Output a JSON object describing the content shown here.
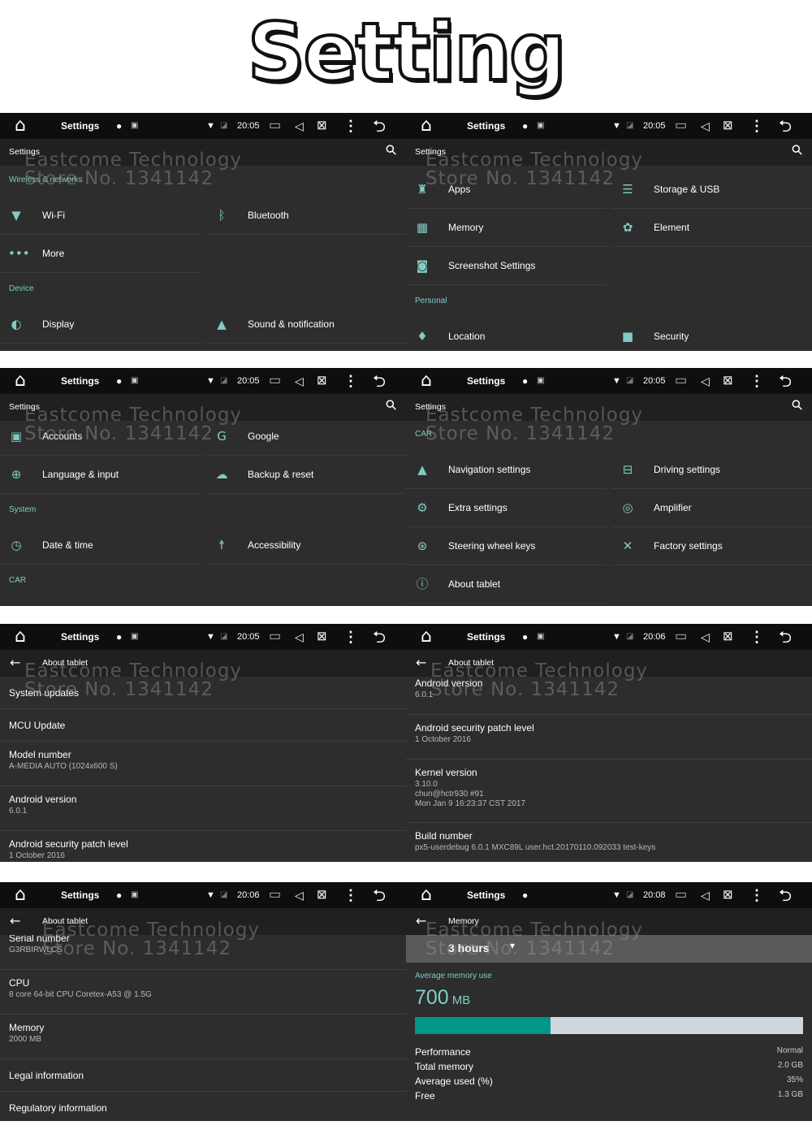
{
  "title": "Setting",
  "watermark": {
    "line1": "Eastcome Technology",
    "line2": "Store No. 1341142"
  },
  "colors": {
    "accent": "#80cbc4",
    "progress_fill": "#009688",
    "progress_track": "#cfd8dc",
    "status_bar": "#0e0e0e",
    "header": "#202020",
    "content": "#2d2d2d"
  },
  "panels": [
    {
      "kind": "grid",
      "status": {
        "app": "Settings",
        "time": "20:05",
        "image_icon": true
      },
      "header": {
        "title": "Settings",
        "back": false,
        "search": true
      },
      "rows": [
        {
          "type": "section",
          "label": "Wireless & networks"
        },
        {
          "type": "items",
          "items": [
            {
              "icon": "wifi-icon",
              "label": "Wi-Fi"
            },
            {
              "icon": "bluetooth-icon",
              "label": "Bluetooth"
            }
          ]
        },
        {
          "type": "items",
          "items": [
            {
              "icon": "more-icon",
              "label": "More"
            }
          ]
        },
        {
          "type": "section",
          "label": "Device"
        },
        {
          "type": "items",
          "items": [
            {
              "icon": "display-icon",
              "label": "Display"
            },
            {
              "icon": "bell-icon",
              "label": "Sound & notification"
            }
          ]
        }
      ]
    },
    {
      "kind": "grid",
      "status": {
        "app": "Settings",
        "time": "20:05",
        "image_icon": true
      },
      "header": {
        "title": "Settings",
        "back": false,
        "search": true
      },
      "rows": [
        {
          "type": "items",
          "items": [
            {
              "icon": "android-icon",
              "label": "Apps"
            },
            {
              "icon": "storage-icon",
              "label": "Storage & USB"
            }
          ]
        },
        {
          "type": "items",
          "items": [
            {
              "icon": "memory-icon",
              "label": "Memory"
            },
            {
              "icon": "element-icon",
              "label": "Element"
            }
          ]
        },
        {
          "type": "items",
          "items": [
            {
              "icon": "camera-icon",
              "label": "Screenshot Settings"
            }
          ]
        },
        {
          "type": "section",
          "label": "Personal"
        },
        {
          "type": "items",
          "items": [
            {
              "icon": "location-icon",
              "label": "Location"
            },
            {
              "icon": "lock-icon",
              "label": "Security"
            }
          ]
        }
      ]
    },
    {
      "kind": "grid",
      "status": {
        "app": "Settings",
        "time": "20:05",
        "image_icon": true
      },
      "header": {
        "title": "Settings",
        "back": false,
        "search": true
      },
      "rows": [
        {
          "type": "items",
          "items": [
            {
              "icon": "account-icon",
              "label": "Accounts"
            },
            {
              "icon": "google-icon",
              "label": "Google"
            }
          ]
        },
        {
          "type": "items",
          "items": [
            {
              "icon": "globe-icon",
              "label": "Language & input"
            },
            {
              "icon": "cloud-upload-icon",
              "label": "Backup & reset"
            }
          ]
        },
        {
          "type": "section",
          "label": "System"
        },
        {
          "type": "items",
          "items": [
            {
              "icon": "clock-icon",
              "label": "Date & time"
            },
            {
              "icon": "accessibility-icon",
              "label": "Accessibility"
            }
          ]
        },
        {
          "type": "section",
          "label": "CAR"
        }
      ]
    },
    {
      "kind": "grid",
      "status": {
        "app": "Settings",
        "time": "20:05",
        "image_icon": true
      },
      "header": {
        "title": "Settings",
        "back": false,
        "search": true
      },
      "rows": [
        {
          "type": "section",
          "label": "CAR"
        },
        {
          "type": "items",
          "items": [
            {
              "icon": "navigation-icon",
              "label": "Navigation settings"
            },
            {
              "icon": "car-icon",
              "label": "Driving settings"
            }
          ]
        },
        {
          "type": "items",
          "items": [
            {
              "icon": "gear-icon",
              "label": "Extra settings"
            },
            {
              "icon": "amplifier-icon",
              "label": "Amplifier"
            }
          ]
        },
        {
          "type": "items",
          "items": [
            {
              "icon": "steering-wheel-icon",
              "label": "Steering wheel keys"
            },
            {
              "icon": "tools-icon",
              "label": "Factory settings"
            }
          ]
        },
        {
          "type": "items",
          "items": [
            {
              "icon": "info-icon",
              "label": "About tablet"
            }
          ]
        }
      ]
    },
    {
      "kind": "list",
      "status": {
        "app": "Settings",
        "time": "20:05",
        "image_icon": true
      },
      "header": {
        "title": "About tablet",
        "back": true,
        "search": false
      },
      "items": [
        {
          "title": "System updates",
          "sub": ""
        },
        {
          "title": "MCU Update",
          "sub": ""
        },
        {
          "title": "Model number",
          "sub": "A-MEDIA AUTO (1024x600 S)"
        },
        {
          "title": "Android version",
          "sub": "6.0.1"
        },
        {
          "title": "Android security patch level",
          "sub": "1 October 2016"
        }
      ]
    },
    {
      "kind": "list",
      "status": {
        "app": "Settings",
        "time": "20:06",
        "image_icon": true
      },
      "header": {
        "title": "About tablet",
        "back": true,
        "search": false
      },
      "items": [
        {
          "title": "Android version",
          "sub": "6.0.1"
        },
        {
          "title": "Android security patch level",
          "sub": "1 October 2016"
        },
        {
          "title": "Kernel version",
          "sub": "3.10.0\nchun@hctr930 #91\nMon Jan 9 16:23:37 CST 2017"
        },
        {
          "title": "Build number",
          "sub": "px5-userdebug 6.0.1 MXC89L user.hct.20170110.092033 test-keys"
        }
      ]
    },
    {
      "kind": "list",
      "status": {
        "app": "Settings",
        "time": "20:06",
        "image_icon": true
      },
      "header": {
        "title": "About tablet",
        "back": true,
        "search": false
      },
      "items": [
        {
          "title": "Serial number",
          "sub": "G3RBIRWLCS"
        },
        {
          "title": "CPU",
          "sub": "8 core 64-bit CPU Coretex-A53 @ 1.5G"
        },
        {
          "title": "Memory",
          "sub": "2000 MB"
        },
        {
          "title": "Legal information",
          "sub": ""
        },
        {
          "title": "Regulatory information",
          "sub": ""
        }
      ]
    },
    {
      "kind": "memory",
      "status": {
        "app": "Settings",
        "time": "20:08",
        "image_icon": false
      },
      "header": {
        "title": "Memory",
        "back": true,
        "search": false
      },
      "memory": {
        "period": "3 hours",
        "avg_label": "Average memory use",
        "avg_value": "700",
        "avg_unit": "MB",
        "used_fraction": 0.35,
        "stats": [
          {
            "label": "Performance",
            "value": "Normal"
          },
          {
            "label": "Total memory",
            "value": "2.0 GB"
          },
          {
            "label": "Average used (%)",
            "value": "35%"
          },
          {
            "label": "Free",
            "value": "1.3 GB"
          }
        ]
      }
    }
  ]
}
